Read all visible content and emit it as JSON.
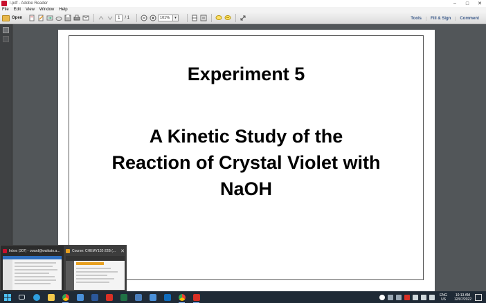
{
  "window": {
    "title": "l.pdf - Adobe Reader",
    "controls": {
      "minimize": "–",
      "maximize": "□",
      "close": "✕"
    }
  },
  "menu": [
    "File",
    "Edit",
    "View",
    "Window",
    "Help"
  ],
  "toolbar": {
    "open_label": "Open",
    "page_current": "1",
    "page_total": "/ 1",
    "zoom_value": "101%",
    "right_tools": [
      "Tools",
      "Fill & Sign",
      "Comment"
    ]
  },
  "document": {
    "title": "Experiment 5",
    "subtitle": "A Kinetic Study of the\nReaction of Crystal Violet with\nNaOH"
  },
  "thumbnails": [
    {
      "title": "Inbox (307) - cward@waikato.a...",
      "icon_color": "#c8102e"
    },
    {
      "title": "Course: CHEMY102-22B (...",
      "icon_color": "#e8a020"
    }
  ],
  "taskbar": {
    "apps": [
      {
        "name": "windows-start",
        "color": "#4fc3f7"
      },
      {
        "name": "task-view",
        "color": "#cfd8dc"
      },
      {
        "name": "edge",
        "color": "#2fa0e0"
      },
      {
        "name": "file-explorer",
        "color": "#f2c94c"
      },
      {
        "name": "chrome",
        "color": "#34a853"
      },
      {
        "name": "store",
        "color": "#4a90d9"
      },
      {
        "name": "word",
        "color": "#2b579a"
      },
      {
        "name": "acrobat",
        "color": "#d93025"
      },
      {
        "name": "excel",
        "color": "#217346"
      },
      {
        "name": "photos",
        "color": "#4a7ebb"
      },
      {
        "name": "folder",
        "color": "#4a90d9"
      },
      {
        "name": "mail",
        "color": "#0f6cbd"
      },
      {
        "name": "chrome-2",
        "color": "#34a853"
      },
      {
        "name": "adobe-reader",
        "color": "#d93025"
      }
    ],
    "language": {
      "line1": "ENG",
      "line2": "US"
    },
    "clock": {
      "time": "10:13 AM",
      "date": "12/07/2022"
    }
  }
}
